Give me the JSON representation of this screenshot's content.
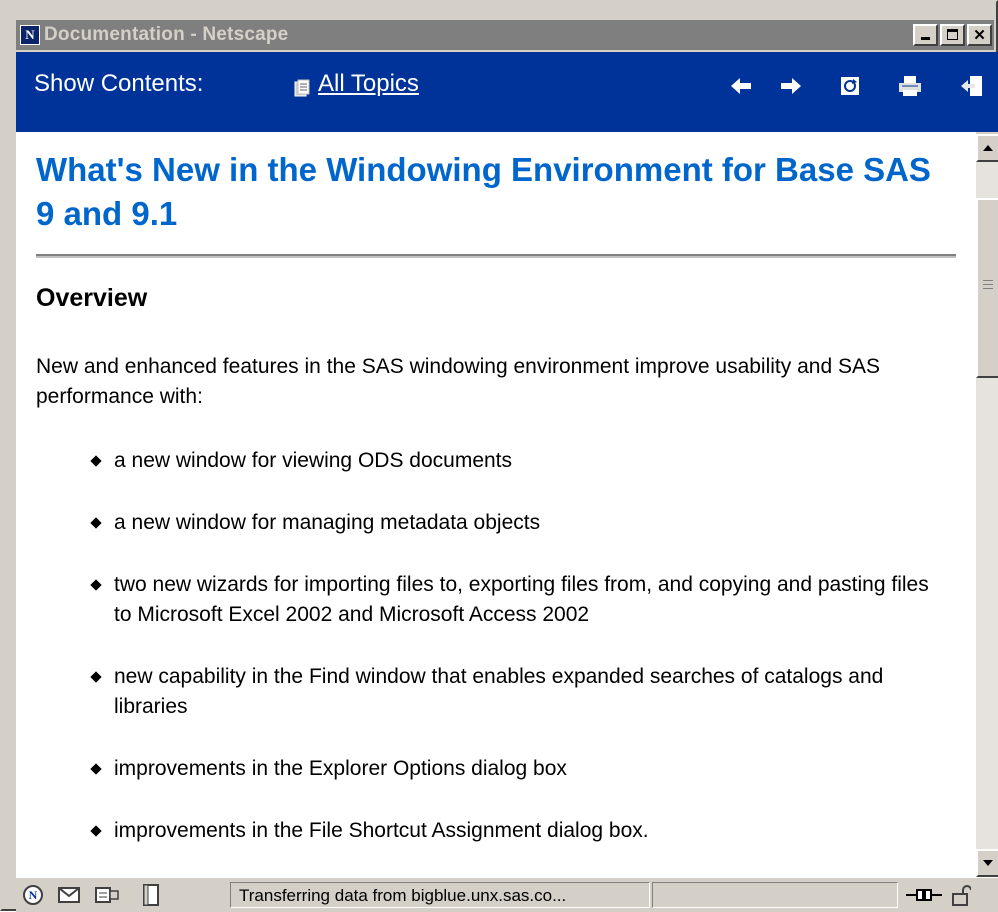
{
  "window": {
    "title": "Documentation - Netscape",
    "app_icon_letter": "N"
  },
  "navbar": {
    "show_contents_label": "Show Contents:",
    "all_topics_link": "All Topics",
    "icons": [
      "back-arrow-icon",
      "forward-arrow-icon",
      "sync-icon",
      "print-icon",
      "exit-icon"
    ]
  },
  "content": {
    "title": "What's New in the Windowing Environment for Base SAS 9 and 9.1",
    "section_heading": "Overview",
    "intro": "New and enhanced features in the SAS windowing environment improve usability and SAS performance with:",
    "bullets": [
      "a new window for viewing ODS documents",
      "a new window for managing metadata objects",
      "two new wizards for importing files to, exporting files from, and copying and pasting files to Microsoft Excel 2002 and Microsoft Access 2002",
      "new capability in the Find window that enables expanded searches of catalogs and libraries",
      "improvements in the Explorer Options dialog box",
      "improvements in the File Shortcut Assignment dialog box."
    ]
  },
  "statusbar": {
    "message": "Transferring data from bigblue.unx.sas.co...",
    "icons": [
      "navigator-icon",
      "mail-icon",
      "composer-icon",
      "document-icon",
      "connection-icon",
      "lock-icon"
    ]
  },
  "colors": {
    "navbar_bg": "#003399",
    "title_color": "#0066cc",
    "titlebar_inactive": "#7f7f7f"
  }
}
